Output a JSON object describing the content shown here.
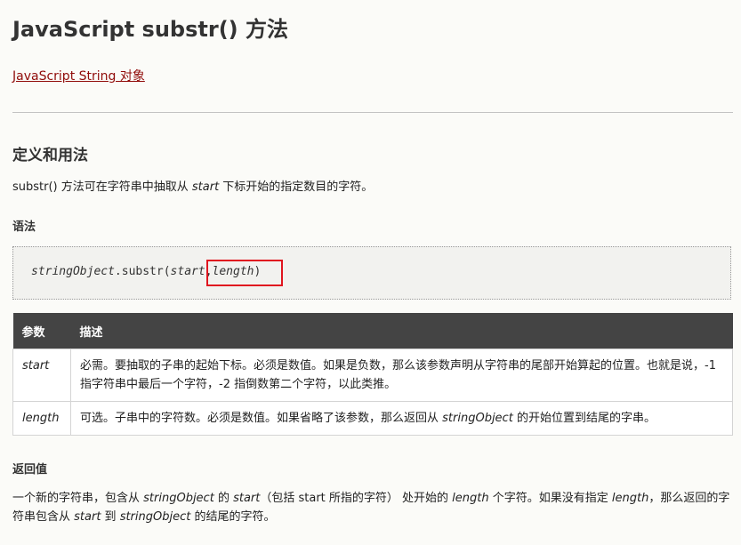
{
  "title": "JavaScript substr() 方法",
  "back_link": "JavaScript String 对象",
  "definition": {
    "heading": "定义和用法",
    "text_parts": [
      "substr() 方法可在字符串中抽取从 ",
      "start",
      " 下标开始的指定数目的字符。"
    ]
  },
  "syntax": {
    "heading": "语法",
    "code_parts": [
      "stringObject",
      ".substr(",
      "start",
      ",",
      "length",
      ")"
    ]
  },
  "params_table": {
    "headers": [
      "参数",
      "描述"
    ],
    "rows": [
      {
        "param": "start",
        "desc": "必需。要抽取的子串的起始下标。必须是数值。如果是负数，那么该参数声明从字符串的尾部开始算起的位置。也就是说，-1 指字符串中最后一个字符，-2 指倒数第二个字符，以此类推。"
      },
      {
        "param": "length",
        "desc_parts": [
          "可选。子串中的字符数。必须是数值。如果省略了该参数，那么返回从 ",
          "stringObject",
          " 的开始位置到结尾的字串。"
        ]
      }
    ]
  },
  "return_value": {
    "heading": "返回值",
    "parts": [
      "一个新的字符串，包含从 ",
      "stringObject",
      " 的 ",
      "start",
      "（包括 start 所指的字符） 处开始的 ",
      "length",
      " 个字符。如果没有指定 ",
      "length",
      "，那么返回的字符串包含从 ",
      "start",
      " 到 ",
      "stringObject",
      " 的结尾的字符。"
    ]
  },
  "colors": {
    "link": "#900b09",
    "table_header_bg": "#444444",
    "highlight": "#e0161f"
  }
}
